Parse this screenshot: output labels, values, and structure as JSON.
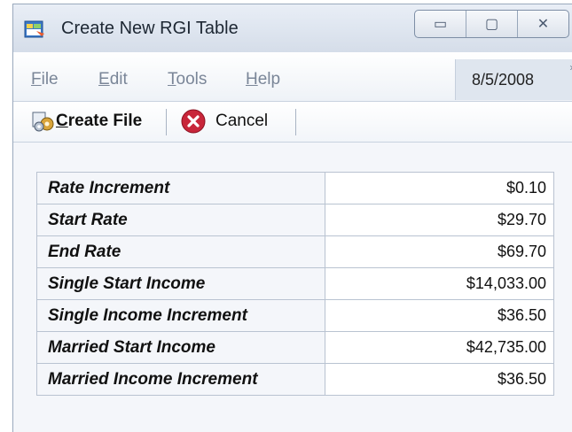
{
  "window": {
    "title": "Create New RGI Table",
    "icon": "table-app-icon",
    "controls": [
      {
        "name": "minimize",
        "glyph": "▭"
      },
      {
        "name": "maximize",
        "glyph": "▢"
      },
      {
        "name": "close",
        "glyph": "✕"
      }
    ]
  },
  "menu": {
    "items": [
      {
        "label": "File",
        "mnemonic": "F"
      },
      {
        "label": "Edit",
        "mnemonic": "E"
      },
      {
        "label": "Tools",
        "mnemonic": "T"
      },
      {
        "label": "Help",
        "mnemonic": "H"
      }
    ],
    "date": "8/5/2008",
    "overflow": "»"
  },
  "toolbar": {
    "create_file_label": "Create File",
    "create_file_icon": "gear-file-icon",
    "cancel_label": "Cancel",
    "cancel_icon": "cancel-x-icon"
  },
  "fields": [
    {
      "label": "Rate Increment",
      "value": "$0.10"
    },
    {
      "label": "Start Rate",
      "value": "$29.70"
    },
    {
      "label": "End Rate",
      "value": "$69.70"
    },
    {
      "label": "Single Start Income",
      "value": "$14,033.00"
    },
    {
      "label": "Single Income Increment",
      "value": "$36.50"
    },
    {
      "label": "Married Start Income",
      "value": "$42,735.00"
    },
    {
      "label": "Married Income Increment",
      "value": "$36.50"
    }
  ],
  "colors": {
    "cancel_red": "#c8263a",
    "titlebar": "#dfe6f0",
    "field_border": "#b9c3d1"
  }
}
